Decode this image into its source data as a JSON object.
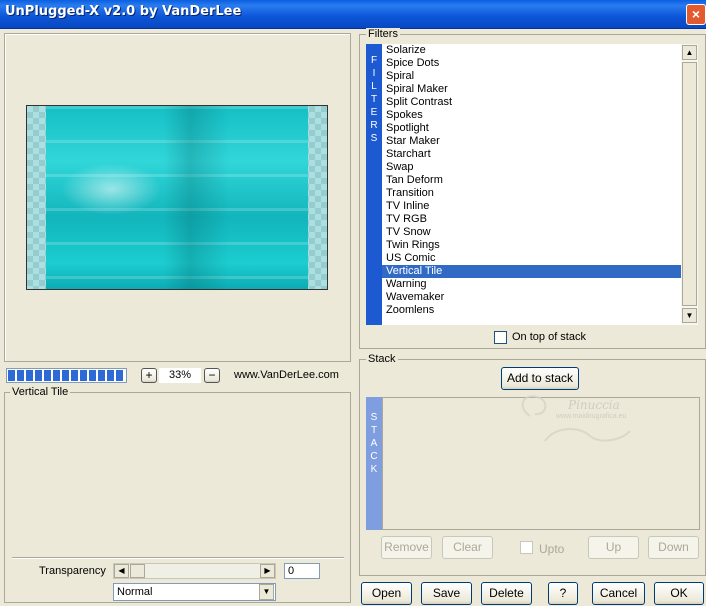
{
  "window": {
    "title": "UnPlugged-X v2.0 by VanDerLee",
    "close": "×"
  },
  "preview": {
    "zoom": "33%",
    "zoom_in": "+",
    "zoom_out": "−",
    "website": "www.VanDerLee.com"
  },
  "settings": {
    "legend": "Vertical Tile",
    "transparency_label": "Transparency",
    "transparency_value": "0",
    "blend_mode": "Normal",
    "slider_left": "◀",
    "slider_right": "▶",
    "dropdown_arrow": "▼"
  },
  "filters": {
    "legend": "Filters",
    "sidebar_text": "FILTERS",
    "items": [
      "Solarize",
      "Spice Dots",
      "Spiral",
      "Spiral Maker",
      "Split Contrast",
      "Spokes",
      "Spotlight",
      "Star Maker",
      "Starchart",
      "Swap",
      "Tan Deform",
      "Transition",
      "TV Inline",
      "TV RGB",
      "TV Snow",
      "Twin Rings",
      "US Comic",
      "Vertical Tile",
      "Warning",
      "Wavemaker",
      "Zoomlens"
    ],
    "selected": "Vertical Tile",
    "on_top_label": "On top of stack",
    "scroll_up": "▲",
    "scroll_down": "▼"
  },
  "stack": {
    "legend": "Stack",
    "add_label": "Add to stack",
    "sidebar_text": "STACK",
    "remove_label": "Remove",
    "clear_label": "Clear",
    "upto_label": "Upto",
    "up_label": "Up",
    "down_label": "Down"
  },
  "watermark": {
    "name": "Pinuccia",
    "url": "www.maidirugrafica.eu"
  },
  "footer": {
    "open": "Open",
    "save": "Save",
    "delete": "Delete",
    "help": "?",
    "cancel": "Cancel",
    "ok": "OK"
  },
  "colors": {
    "titlebar": "#0b55d8",
    "selection": "#316ac5",
    "preview": "#1ec8cc",
    "progress": "#2d6ad6"
  }
}
